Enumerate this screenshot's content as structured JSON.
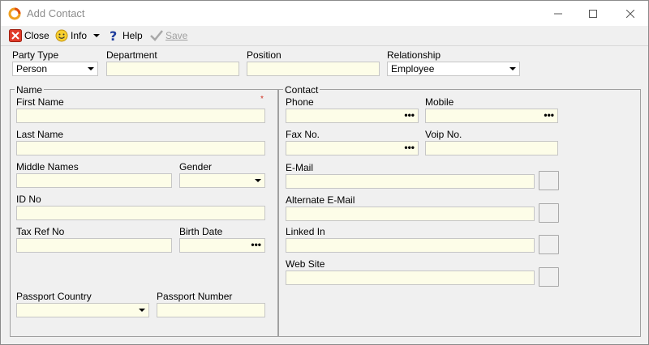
{
  "window": {
    "title": "Add Contact"
  },
  "toolbar": {
    "close_label": "Close",
    "info_label": "Info",
    "help_label": "Help",
    "save_label": "Save"
  },
  "top": {
    "party_type_label": "Party Type",
    "party_type_value": "Person",
    "department_label": "Department",
    "department_value": "",
    "position_label": "Position",
    "position_value": "",
    "relationship_label": "Relationship",
    "relationship_value": "Employee"
  },
  "name_group": {
    "title": "Name",
    "required_mark": "*",
    "first_name_label": "First Name",
    "last_name_label": "Last Name",
    "middle_names_label": "Middle Names",
    "gender_label": "Gender",
    "id_no_label": "ID No",
    "tax_ref_label": "Tax Ref No",
    "birth_date_label": "Birth Date",
    "passport_country_label": "Passport Country",
    "passport_number_label": "Passport Number"
  },
  "contact_group": {
    "title": "Contact",
    "phone_label": "Phone",
    "mobile_label": "Mobile",
    "fax_label": "Fax No.",
    "voip_label": "Voip No.",
    "email_label": "E-Mail",
    "alt_email_label": "Alternate E-Mail",
    "linkedin_label": "Linked In",
    "website_label": "Web Site"
  },
  "ellipsis": "•••",
  "icons": [
    "app-logo-icon",
    "close-red-x-icon",
    "smiley-info-icon",
    "help-question-icon",
    "save-check-icon",
    "minimize-icon",
    "maximize-icon",
    "window-close-icon",
    "dropdown-arrow-icon"
  ]
}
